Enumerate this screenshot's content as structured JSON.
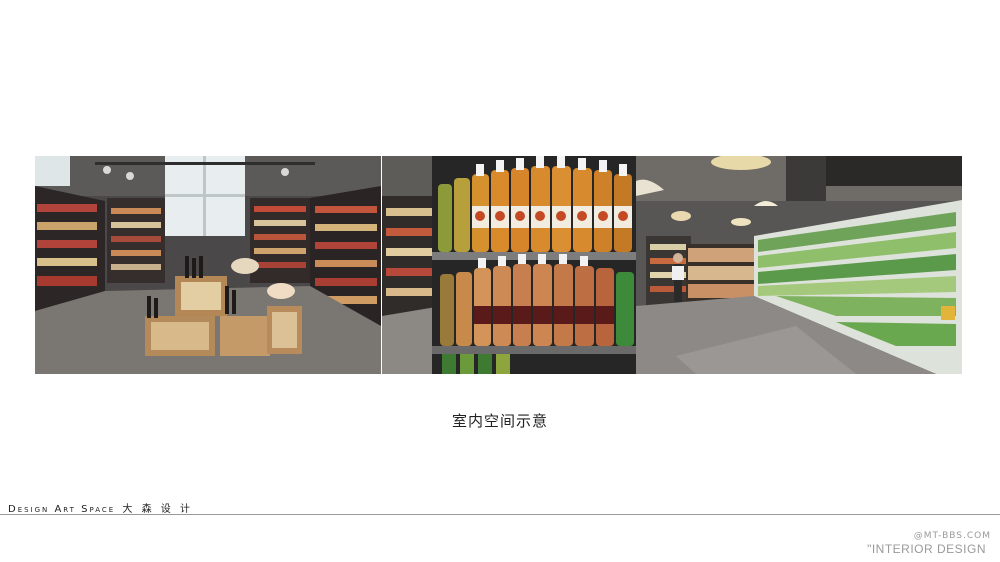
{
  "caption": "室内空间示意",
  "brand": {
    "latin": "Design Art Space",
    "cn": "大 森 设 计"
  },
  "watermark": {
    "site": "@MT-BBS.COM",
    "label": "\"INTERIOR DESIGN"
  },
  "photos": [
    {
      "name": "supermarket-wine-display-photo"
    },
    {
      "name": "juice-bottle-shelf-photo"
    },
    {
      "name": "produce-refrigerator-aisle-photo"
    }
  ]
}
